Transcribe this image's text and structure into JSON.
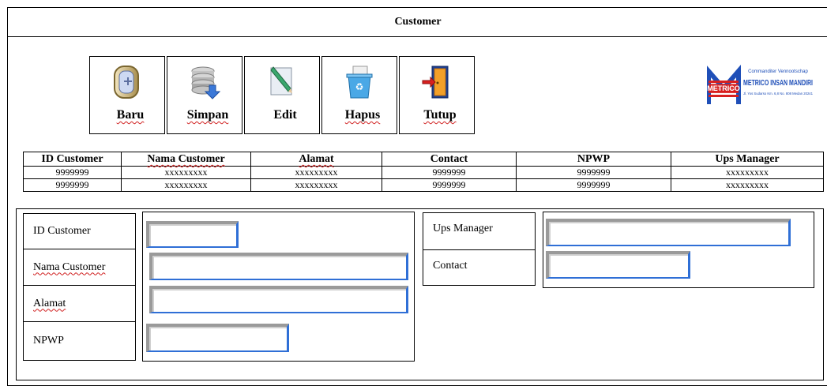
{
  "window": {
    "title": "Customer"
  },
  "toolbar": {
    "buttons": [
      {
        "label": "Baru",
        "icon": "new-document-icon"
      },
      {
        "label": "Simpan",
        "icon": "save-database-icon"
      },
      {
        "label": "Edit",
        "icon": "edit-pencil-icon"
      },
      {
        "label": "Hapus",
        "icon": "recycle-bin-icon"
      },
      {
        "label": "Tutup",
        "icon": "exit-door-icon"
      }
    ]
  },
  "logo": {
    "company_line1": "Commanditer Vennootschap",
    "company_name": "METRICO INSAN MANDIRI",
    "address": "Jl. Yos Sudarso Km. 6,8 No. 808 Medan 20241",
    "brand_mark": "METRICO"
  },
  "table": {
    "columns": [
      "ID Customer",
      "Nama Customer",
      "Alamat",
      "Contact",
      "NPWP",
      "Ups Manager"
    ],
    "rows": [
      [
        "9999999",
        "xxxxxxxxx",
        "xxxxxxxxx",
        "9999999",
        "9999999",
        "xxxxxxxxx"
      ],
      [
        "9999999",
        "xxxxxxxxx",
        "xxxxxxxxx",
        "9999999",
        "9999999",
        "xxxxxxxxx"
      ]
    ]
  },
  "form": {
    "left_labels": [
      "ID Customer",
      "Nama Customer",
      "Alamat",
      "NPWP"
    ],
    "right_labels": [
      "Ups Manager",
      "Contact"
    ],
    "values": {
      "id_customer": "",
      "nama_customer": "",
      "alamat": "",
      "npwp": "",
      "ups_manager": "",
      "contact": ""
    }
  },
  "colors": {
    "field_border_dark": "#9a9a9a",
    "field_border_accent": "#2f6fd6",
    "logo_blue": "#1f4fb8",
    "logo_red": "#d8201f"
  }
}
